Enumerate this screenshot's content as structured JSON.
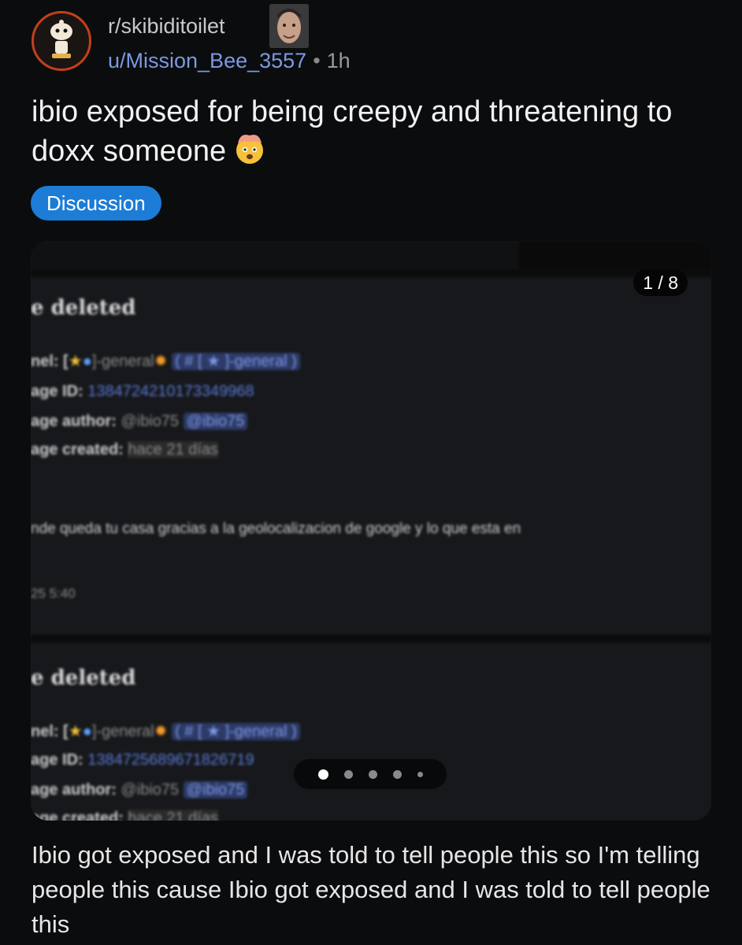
{
  "header": {
    "subreddit": "r/skibiditoilet",
    "username": "u/Mission_Bee_3557",
    "separator": "•",
    "time": "1h"
  },
  "post": {
    "title": "ibio exposed for being creepy and threatening to doxx someone",
    "title_emoji": "exploding-head-icon",
    "flair": "Discussion",
    "flair_color": "#1c7cd6",
    "body": "Ibio got exposed and I was told to tell people this so I'm telling people this cause Ibio got exposed and I was told to tell people this"
  },
  "gallery": {
    "counter": "1 / 8",
    "dots": [
      "active",
      "normal",
      "normal",
      "normal",
      "small"
    ],
    "block1": {
      "title": "e deleted",
      "channel_prefix": "nel: [",
      "channel_name": "]-general",
      "channel_alt": "( # [ ★ ]-general )",
      "id_label": "age ID:",
      "id_value": "1384724210173349968",
      "author_label": "age author:",
      "author_value": "@ibio75",
      "author_mention": "@ibio75",
      "created_label": "age created:",
      "created_value": "hace 21 días",
      "message": "nde queda tu casa gracias a la geolocalizacion de google y lo que esta en",
      "timestamp": "25 5:40"
    },
    "block2": {
      "title": "e deleted",
      "channel_prefix": "nel: [",
      "channel_name": "]-general",
      "channel_alt": "( # [ ★ ]-general )",
      "id_label": "age ID:",
      "id_value": "1384725689671826719",
      "author_label": "age author:",
      "author_value": "@ibio75",
      "author_mention": "@ibio75",
      "created_label": "age created:",
      "created_value": "hace 21 días"
    }
  }
}
